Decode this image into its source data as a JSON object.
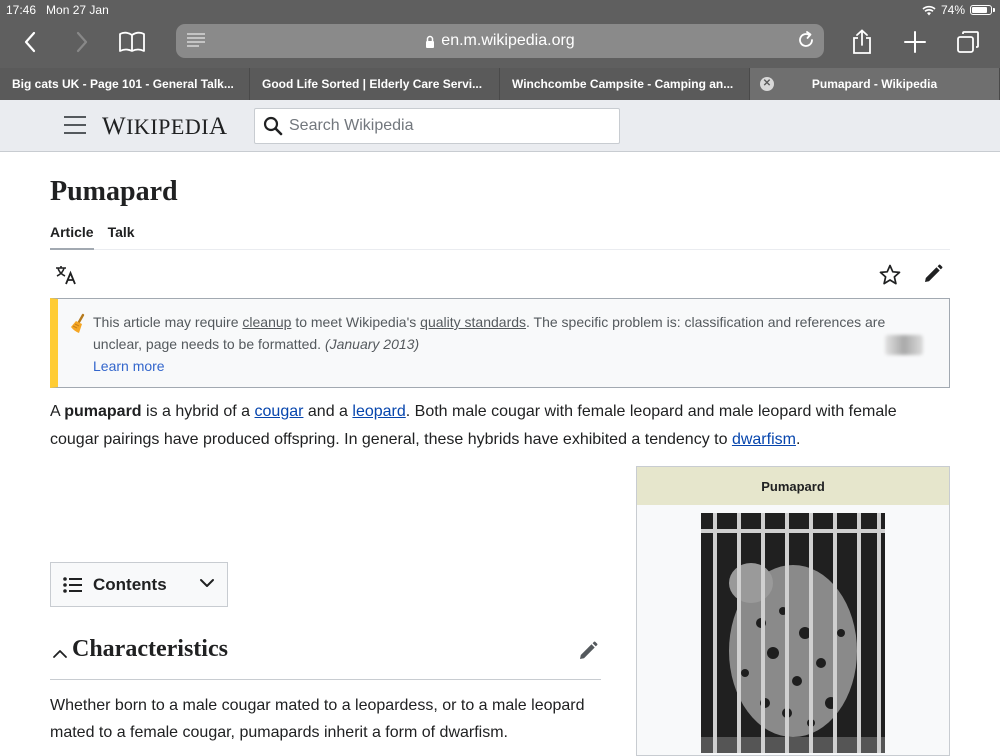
{
  "status": {
    "time": "17:46",
    "date": "Mon 27 Jan",
    "battery": "74%"
  },
  "browser": {
    "url": "en.m.wikipedia.org",
    "tabs": [
      {
        "title": "Big cats UK - Page 101 - General Talk..."
      },
      {
        "title": "Good Life Sorted | Elderly Care Servi..."
      },
      {
        "title": "Winchcombe Campsite - Camping an..."
      },
      {
        "title": "Pumapard - Wikipedia"
      }
    ]
  },
  "wiki": {
    "wordmark_first": "W",
    "wordmark_rest": "IKIPEDI",
    "wordmark_last": "A",
    "search_placeholder": "Search Wikipedia"
  },
  "article": {
    "title": "Pumapard",
    "tabs": [
      "Article",
      "Talk"
    ],
    "notice": {
      "text_1": "This article may require ",
      "link_cleanup": "cleanup",
      "text_2": " to meet Wikipedia's ",
      "link_quality": "quality standards",
      "text_3": ". The specific problem is: classification and references are unclear, page needs to be formatted. ",
      "date": "(January 2013)",
      "learn_more": "Learn more"
    },
    "intro": {
      "p1": "A ",
      "bold": "pumapard",
      "p2": " is a hybrid of a ",
      "link_cougar": "cougar",
      "p3": " and a ",
      "link_leopard": "leopard",
      "p4": ". Both male cougar with female leopard and male leopard with female cougar pairings have produced offspring. In general, these hybrids have exhibited a tendency to ",
      "link_dwarfism": "dwarfism",
      "p5": "."
    },
    "contents_label": "Contents",
    "section": {
      "title": "Characteristics",
      "text": "Whether born to a male cougar mated to a leopardess, or to a male leopard mated to a female cougar, pumapards inherit a form of dwarfism."
    },
    "infobox": {
      "title": "Pumapard"
    }
  },
  "colors": {
    "link": "#0645ad",
    "notice_bar": "#ffcc33",
    "chrome": "#5f5f5f"
  }
}
